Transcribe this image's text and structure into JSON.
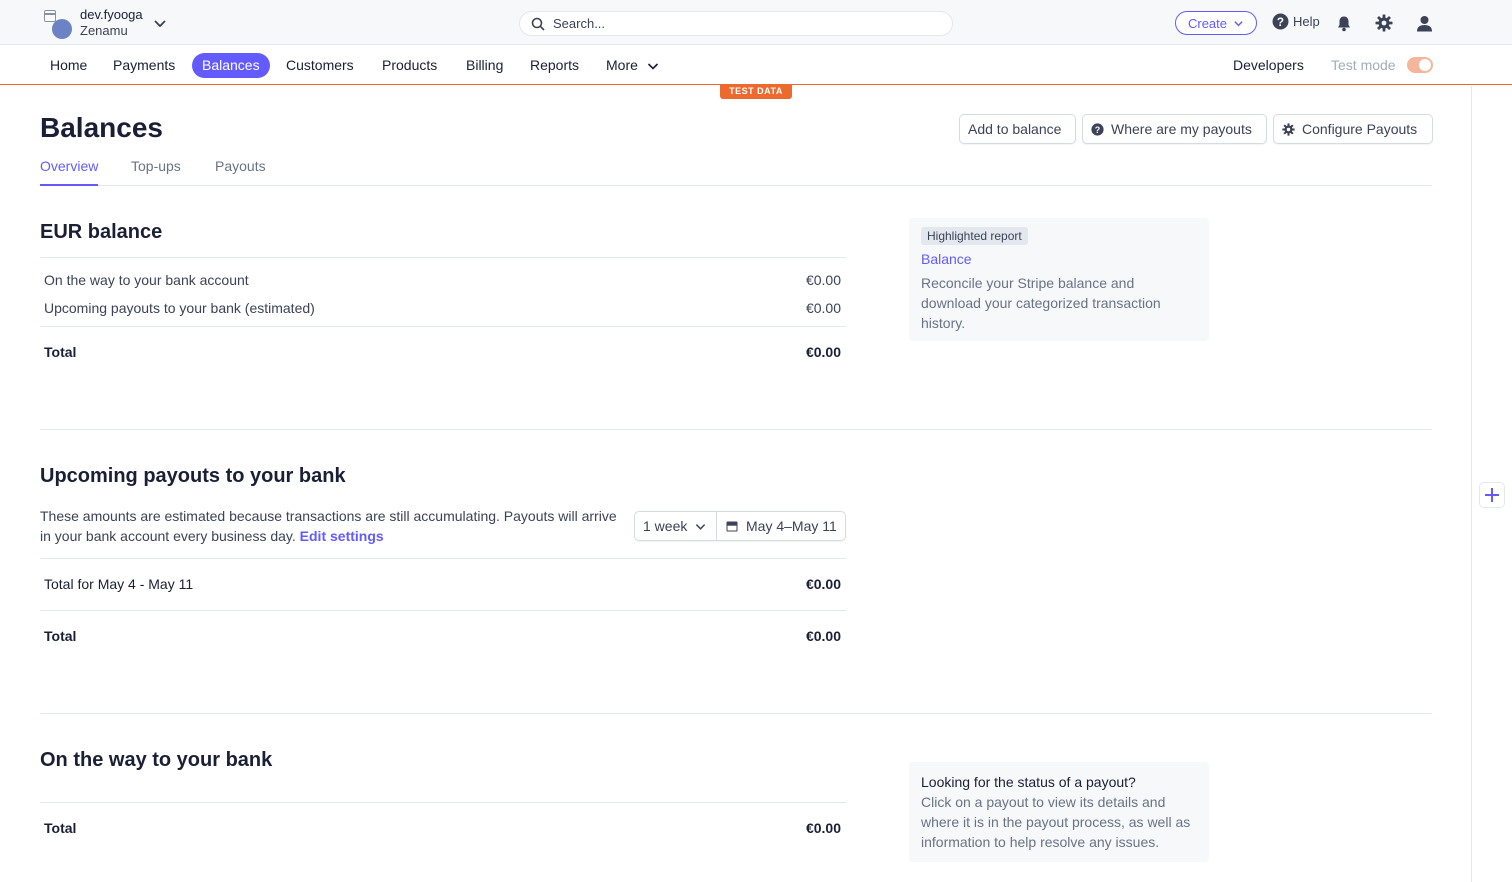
{
  "account": {
    "name": "dev.fyooga",
    "org": "Zenamu"
  },
  "search": {
    "placeholder": "Search..."
  },
  "topbar": {
    "create_label": "Create",
    "help_label": "Help"
  },
  "nav": {
    "items": [
      "Home",
      "Payments",
      "Balances",
      "Customers",
      "Products",
      "Billing",
      "Reports",
      "More"
    ],
    "active": "Balances",
    "developers_label": "Developers",
    "test_mode_label": "Test mode",
    "test_mode_on": true
  },
  "test_badge": "TEST DATA",
  "page": {
    "title": "Balances",
    "buttons": {
      "add": "Add to balance",
      "where": "Where are my payouts",
      "configure": "Configure Payouts"
    },
    "tabs": [
      "Overview",
      "Top-ups",
      "Payouts"
    ],
    "active_tab": "Overview"
  },
  "eur_balance": {
    "heading": "EUR balance",
    "rows": [
      {
        "label": "On the way to your bank account",
        "value": "€0.00"
      },
      {
        "label": "Upcoming payouts to your bank (estimated)",
        "value": "€0.00"
      }
    ],
    "total_label": "Total",
    "total_value": "€0.00"
  },
  "highlighted_report": {
    "chip": "Highlighted report",
    "title": "Balance",
    "description": "Reconcile your Stripe balance and download your categorized transaction history."
  },
  "upcoming": {
    "heading": "Upcoming payouts to your bank",
    "description": "These amounts are estimated because transactions are still accumulating. Payouts will arrive in your bank account every business day.",
    "edit_link": "Edit settings",
    "period_select": "1 week",
    "date_range": "May 4–May 11",
    "row_label": "Total for May 4 - May 11",
    "row_value": "€0.00",
    "total_label": "Total",
    "total_value": "€0.00"
  },
  "on_the_way": {
    "heading": "On the way to your bank",
    "total_label": "Total",
    "total_value": "€0.00"
  },
  "status_card": {
    "title": "Looking for the status of a payout?",
    "description": "Click on a payout to view its details and where it is in the payout process, as well as information to help resolve any issues."
  },
  "colors": {
    "accent": "#635bff",
    "test_mode": "#ed6a2f"
  }
}
